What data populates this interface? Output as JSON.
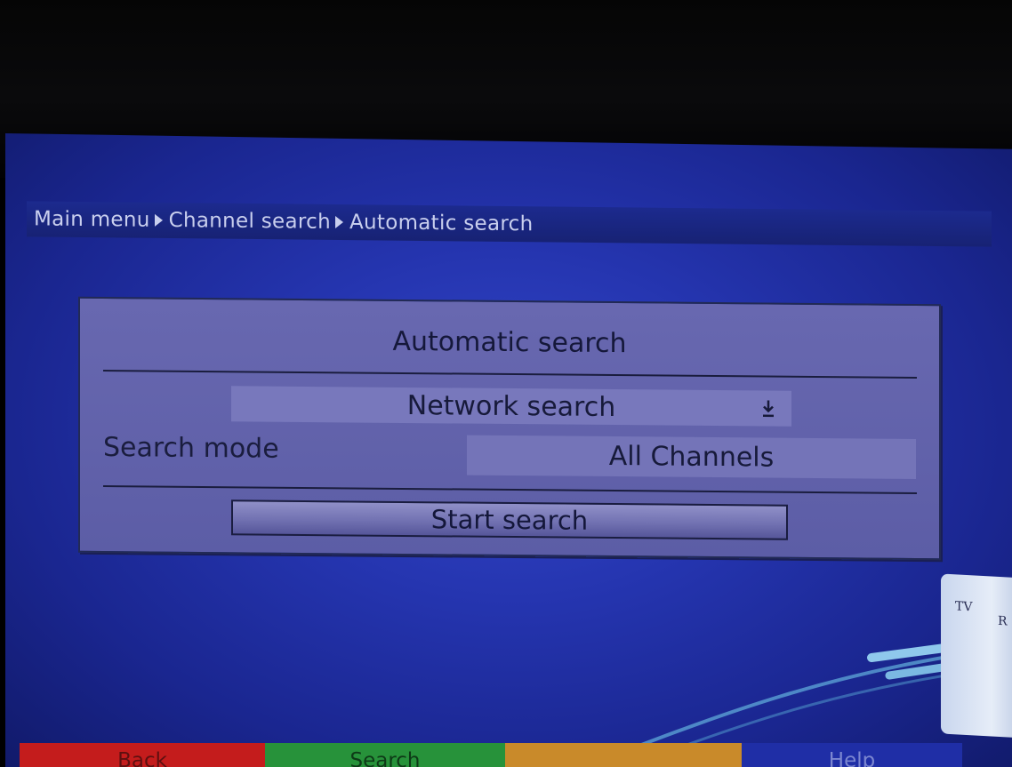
{
  "breadcrumb": {
    "items": [
      "Main menu",
      "Channel search",
      "Automatic search"
    ]
  },
  "dialog": {
    "title": "Automatic search",
    "network_search": {
      "value": "Network search",
      "icon": "download-arrow-icon"
    },
    "search_mode": {
      "label": "Search mode",
      "value": "All Channels"
    },
    "start_button": "Start search"
  },
  "socket": {
    "tv_label": "TV",
    "r_label": "R"
  },
  "color_keys": {
    "red": "Back",
    "green": "Search",
    "yellow": "",
    "blue": "Help"
  },
  "colors": {
    "background": "#2535b0",
    "dialog": "#6464ac",
    "red_key": "#c41c1c",
    "green_key": "#27923a",
    "yellow_key": "#c98a2a",
    "blue_key": "#1f2ea6"
  }
}
